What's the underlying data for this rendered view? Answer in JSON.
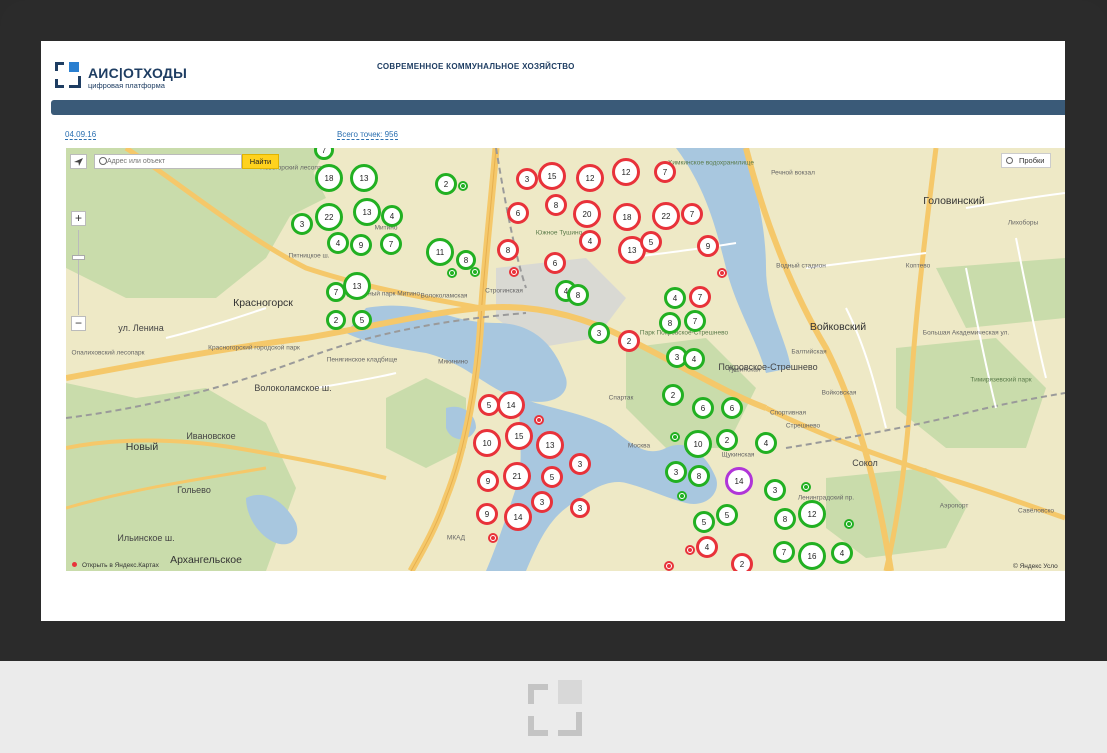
{
  "app": {
    "logo_text": "АИС|ОТХОДЫ",
    "logo_subtitle": "цифровая платформа",
    "tagline": "СОВРЕМЕННОЕ КОММУНАЛЬНОЕ ХОЗЯЙСТВО"
  },
  "colors": {
    "brand": "#1e3d62",
    "navbar": "#3a5a78",
    "cluster_green": "#22b022",
    "cluster_red": "#e8323a",
    "cluster_purple": "#b035d8",
    "search_button": "#ffd21e"
  },
  "info": {
    "date": "04.09.16",
    "total_points": "Всего точек: 956"
  },
  "map_controls": {
    "search_placeholder": "Адрес или объект",
    "search_button": "Найти",
    "traffic_button": "Пробки",
    "zoom_in": "+",
    "zoom_out": "−",
    "open_in_yandex": "Открыть в Яндекс.Картах",
    "copyright": "© Яндекс Усло"
  },
  "place_labels": [
    "Красногорск",
    "Новый",
    "Архангельское",
    "Гольево",
    "Ивановское",
    "Волоколамская",
    "Мякинино",
    "Спартак",
    "Тушинская",
    "Щукинская",
    "Войковский",
    "Головинский",
    "Коптево",
    "Сокол",
    "Стрешнево",
    "Южное Тушино",
    "Покровское-Стрешнево",
    "Балтийская",
    "Водный стадион",
    "Речной вокзал",
    "Лихоборы",
    "Аэропорт",
    "Савёловско",
    "Пятницкое ш.",
    "МКАД",
    "Волоколамское ш.",
    "ул. Ленина",
    "Ильинское ш.",
    "Новогорский лесопарк",
    "Опалиховский лесопарк",
    "Красногорский городской парк",
    "Пенягинское кладбище",
    "Ландшафтный парк Митино",
    "Войковская",
    "Спортивная",
    "Строгинская",
    "Митино",
    "Химкинское водохранилище",
    "Тимирязевский парк",
    "Парк Покровское-Стрешнево",
    "Ленинградский пр.",
    "Большая Академическая ул.",
    "Москва"
  ],
  "clusters": [
    {
      "count": "7",
      "color": "g"
    },
    {
      "count": "18",
      "color": "g"
    },
    {
      "count": "13",
      "color": "g"
    },
    {
      "count": "22",
      "color": "g"
    },
    {
      "count": "3",
      "color": "g"
    },
    {
      "count": "13",
      "color": "g"
    },
    {
      "count": "4",
      "color": "g"
    },
    {
      "count": "9",
      "color": "g"
    },
    {
      "count": "4",
      "color": "g"
    },
    {
      "count": "7",
      "color": "g"
    },
    {
      "count": "13",
      "color": "g"
    },
    {
      "count": "2",
      "color": "g"
    },
    {
      "count": "7",
      "color": "g"
    },
    {
      "count": "5",
      "color": "g"
    },
    {
      "count": "2",
      "color": "g"
    },
    {
      "count": "11",
      "color": "g"
    },
    {
      "count": "8",
      "color": "g"
    },
    {
      "count": "3",
      "color": "r"
    },
    {
      "count": "15",
      "color": "r"
    },
    {
      "count": "12",
      "color": "r"
    },
    {
      "count": "12",
      "color": "r"
    },
    {
      "count": "7",
      "color": "r"
    },
    {
      "count": "6",
      "color": "r"
    },
    {
      "count": "8",
      "color": "r"
    },
    {
      "count": "20",
      "color": "r"
    },
    {
      "count": "18",
      "color": "r"
    },
    {
      "count": "22",
      "color": "r"
    },
    {
      "count": "7",
      "color": "r"
    },
    {
      "count": "8",
      "color": "r"
    },
    {
      "count": "4",
      "color": "r"
    },
    {
      "count": "13",
      "color": "r"
    },
    {
      "count": "5",
      "color": "r"
    },
    {
      "count": "9",
      "color": "r"
    },
    {
      "count": "6",
      "color": "r"
    },
    {
      "count": "4",
      "color": "g"
    },
    {
      "count": "8",
      "color": "g"
    },
    {
      "count": "4",
      "color": "g"
    },
    {
      "count": "7",
      "color": "r"
    },
    {
      "count": "8",
      "color": "g"
    },
    {
      "count": "7",
      "color": "g"
    },
    {
      "count": "3",
      "color": "g"
    },
    {
      "count": "2",
      "color": "r"
    },
    {
      "count": "3",
      "color": "g"
    },
    {
      "count": "4",
      "color": "g"
    },
    {
      "count": "2",
      "color": "g"
    },
    {
      "count": "6",
      "color": "g"
    },
    {
      "count": "6",
      "color": "g"
    },
    {
      "count": "10",
      "color": "g"
    },
    {
      "count": "2",
      "color": "g"
    },
    {
      "count": "4",
      "color": "g"
    },
    {
      "count": "3",
      "color": "g"
    },
    {
      "count": "8",
      "color": "g"
    },
    {
      "count": "14",
      "color": "p"
    },
    {
      "count": "3",
      "color": "g"
    },
    {
      "count": "5",
      "color": "g"
    },
    {
      "count": "5",
      "color": "g"
    },
    {
      "count": "4",
      "color": "r"
    },
    {
      "count": "8",
      "color": "g"
    },
    {
      "count": "12",
      "color": "g"
    },
    {
      "count": "7",
      "color": "g"
    },
    {
      "count": "16",
      "color": "g"
    },
    {
      "count": "4",
      "color": "g"
    },
    {
      "count": "2",
      "color": "r"
    },
    {
      "count": "5",
      "color": "r"
    },
    {
      "count": "14",
      "color": "r"
    },
    {
      "count": "10",
      "color": "r"
    },
    {
      "count": "15",
      "color": "r"
    },
    {
      "count": "13",
      "color": "r"
    },
    {
      "count": "9",
      "color": "r"
    },
    {
      "count": "21",
      "color": "r"
    },
    {
      "count": "5",
      "color": "r"
    },
    {
      "count": "3",
      "color": "r"
    },
    {
      "count": "9",
      "color": "r"
    },
    {
      "count": "14",
      "color": "r"
    },
    {
      "count": "3",
      "color": "r"
    },
    {
      "count": "3",
      "color": "r"
    }
  ]
}
